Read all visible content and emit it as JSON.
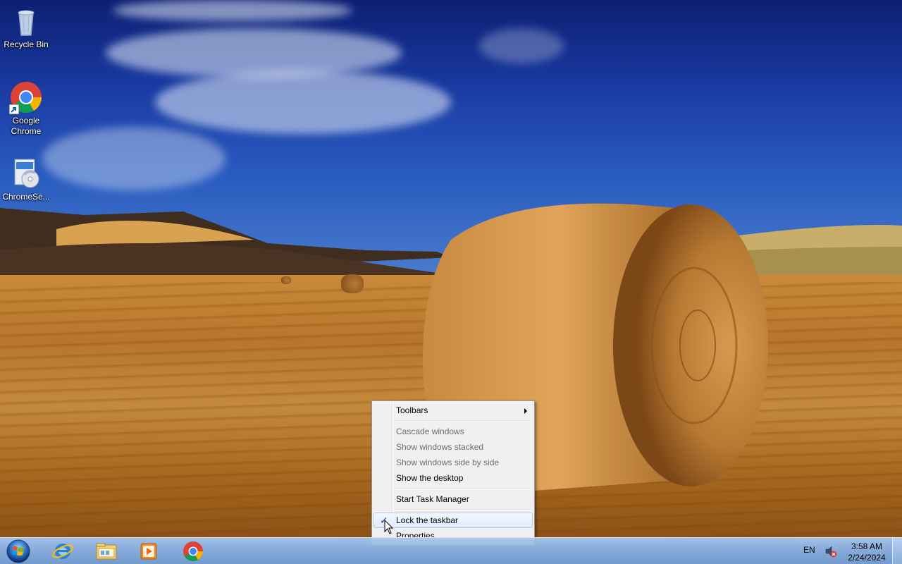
{
  "desktop": {
    "icons": [
      {
        "label": "Recycle Bin",
        "icon": "recycle-bin-icon"
      },
      {
        "label": "Google Chrome",
        "icon": "chrome-icon"
      },
      {
        "label": "ChromeSe...",
        "icon": "installer-icon"
      }
    ]
  },
  "context_menu": {
    "items": [
      {
        "label": "Toolbars",
        "enabled": true,
        "submenu": true
      },
      {
        "label": "Cascade windows",
        "enabled": false
      },
      {
        "label": "Show windows stacked",
        "enabled": false
      },
      {
        "label": "Show windows side by side",
        "enabled": false
      },
      {
        "label": "Show the desktop",
        "enabled": true
      },
      {
        "label": "Start Task Manager",
        "enabled": true
      },
      {
        "label": "Lock the taskbar",
        "enabled": true,
        "checked": true,
        "highlighted": true
      },
      {
        "label": "Properties",
        "enabled": true
      }
    ],
    "check_mark": "✓"
  },
  "taskbar": {
    "pinned": [
      {
        "icon": "start-orb-icon"
      },
      {
        "icon": "internet-explorer-icon"
      },
      {
        "icon": "file-explorer-icon"
      },
      {
        "icon": "media-player-icon"
      },
      {
        "icon": "chrome-icon"
      }
    ],
    "tray": {
      "language": "EN",
      "volume_icon": "volume-muted-icon",
      "time": "3:58 AM",
      "date": "2/24/2024"
    }
  }
}
